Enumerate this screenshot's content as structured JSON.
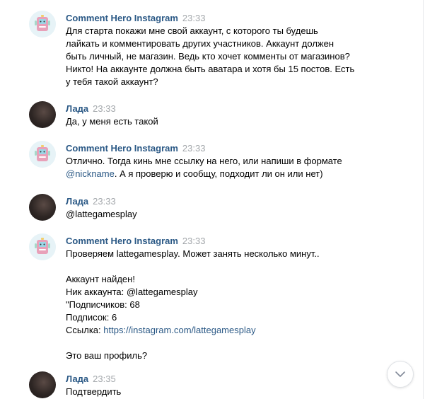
{
  "messages": [
    {
      "author": "Comment Hero Instagram",
      "time": "23:33",
      "avatar": "bot-icon",
      "lines": [
        "Для старта покажи мне свой аккаунт, с которого ты будешь",
        "лайкать и комментировать других участников. Аккаунт должен",
        "быть личный, не магазин. Ведь кто хочет комменты от магазинов?",
        "Никто! На аккаунте должна быть аватара и хотя бы 15 постов. Есть",
        "у тебя такой аккаунт?"
      ]
    },
    {
      "author": "Лада",
      "time": "23:33",
      "avatar": "user-avatar",
      "lines": [
        "Да, у меня есть такой"
      ]
    },
    {
      "author": "Comment Hero Instagram",
      "time": "23:33",
      "avatar": "bot-icon",
      "lines": [
        "Отлично. Тогда кинь мне ссылку на него, или напиши в формате",
        "А я проверю и сообщу, подходит ли он или нет)"
      ],
      "nickname_link": "@nickname"
    },
    {
      "author": "Лада",
      "time": "23:33",
      "avatar": "user-avatar",
      "lines": [
        "@lattegamesplay"
      ]
    },
    {
      "author": "Comment Hero Instagram",
      "time": "23:33",
      "avatar": "bot-icon",
      "lines": [
        "Проверяем lattegamesplay. Может занять несколько минут..",
        "Аккаунт найден!",
        "Ник аккаунта: @lattegamesplay",
        "\"Подписчиков: 68",
        "Подписок: 6",
        "Ссылка:",
        "Это ваш профиль?"
      ],
      "profile_link": "https://instagram.com/lattegamesplay"
    },
    {
      "author": "Лада",
      "time": "23:35",
      "avatar": "user-avatar",
      "lines": [
        "Подтвердить"
      ]
    }
  ],
  "colors": {
    "author": "#2a5885",
    "time": "#a3a7ab",
    "link": "#2a5885",
    "text": "#000000"
  },
  "scroll_button": {
    "icon": "chevron-down-icon"
  }
}
